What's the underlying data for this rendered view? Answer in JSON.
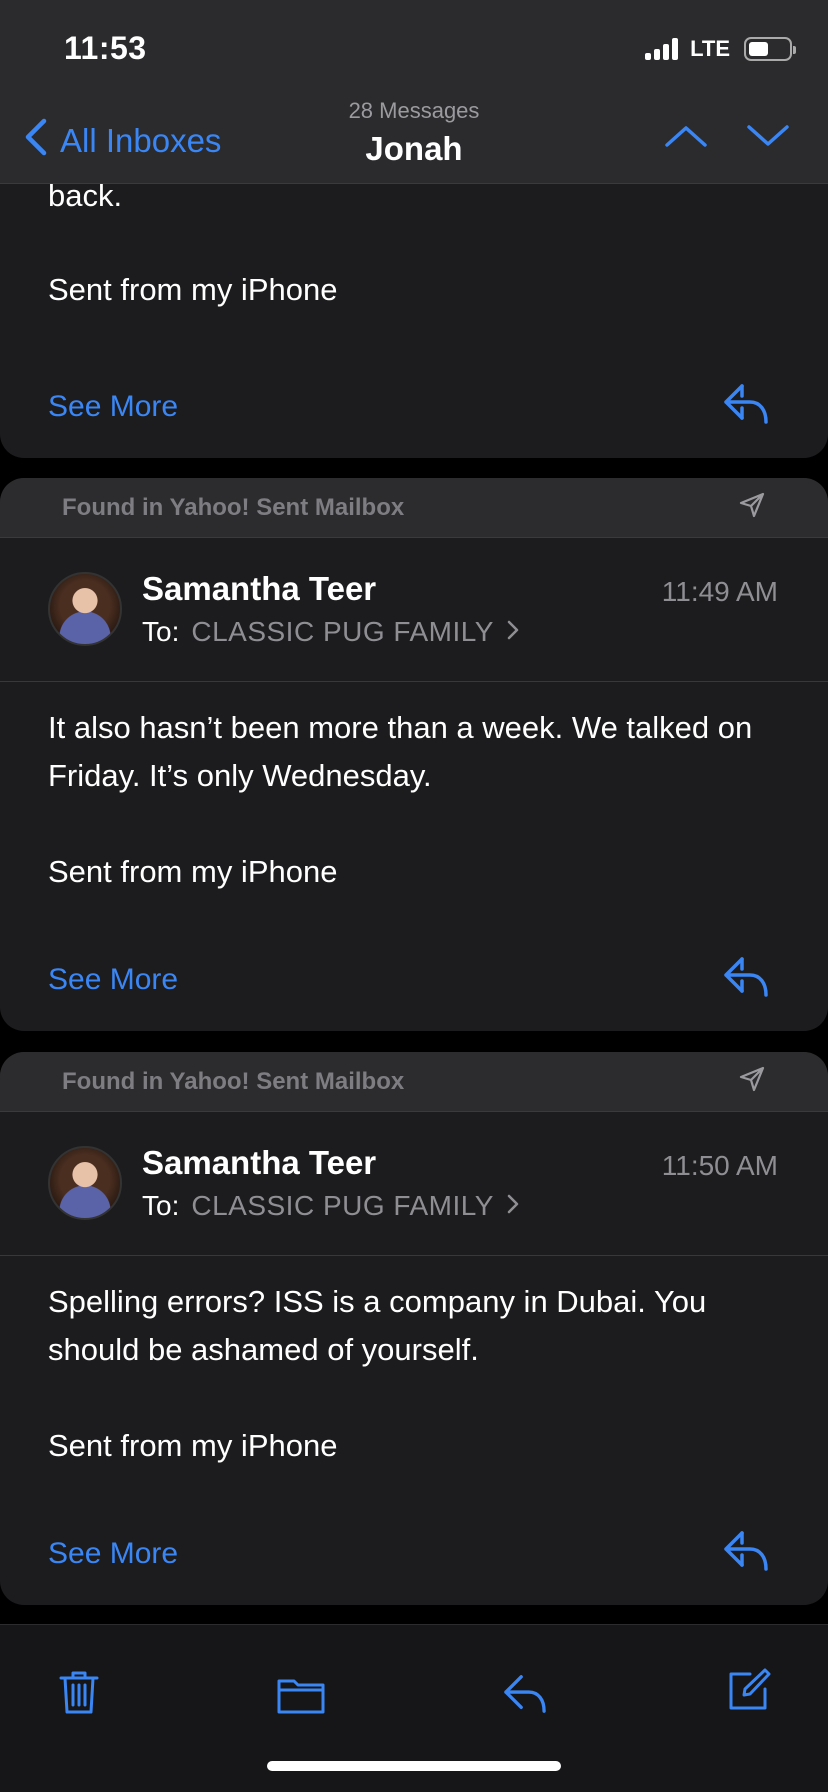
{
  "status": {
    "time": "11:53",
    "network": "LTE"
  },
  "nav": {
    "back_label": "All Inboxes",
    "subtitle": "28 Messages",
    "title": "Jonah"
  },
  "messages": [
    {
      "partial": true,
      "body": [
        "back.",
        "Sent from my iPhone"
      ],
      "see_more": "See More"
    },
    {
      "found_in": "Found in Yahoo! Sent Mailbox",
      "sender": "Samantha Teer",
      "to_label": "To:",
      "to": "CLASSIC PUG FAMILY",
      "time": "11:49 AM",
      "body": [
        "It also hasn’t been more than a week. We talked on Friday. It’s only Wednesday.",
        "Sent from my iPhone"
      ],
      "see_more": "See More"
    },
    {
      "found_in": "Found in Yahoo! Sent Mailbox",
      "sender": "Samantha Teer",
      "to_label": "To:",
      "to": "CLASSIC PUG FAMILY",
      "time": "11:50 AM",
      "body": [
        "Spelling errors? ISS is a company in Dubai. You should be ashamed of yourself.",
        "Sent from my iPhone"
      ],
      "see_more": "See More"
    }
  ],
  "toolbar": [
    "trash-icon",
    "folder-icon",
    "reply-icon",
    "compose-icon"
  ],
  "colors": {
    "accent": "#3a86f5",
    "card": "#1c1c1e",
    "background": "#000000"
  }
}
